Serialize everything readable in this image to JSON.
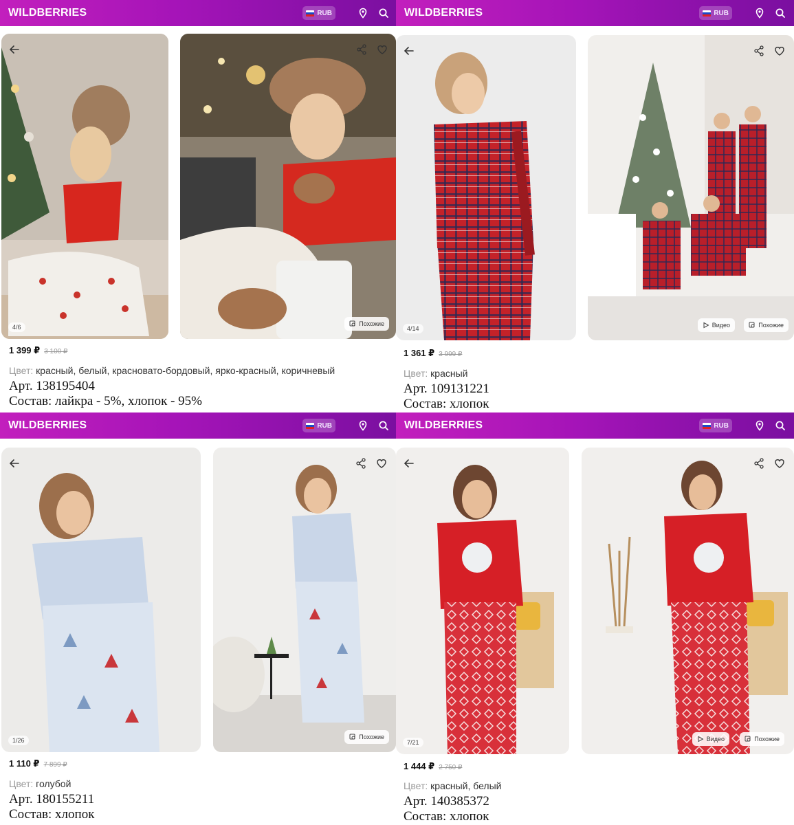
{
  "app": {
    "logo": "WILDBERRIES",
    "currency": "RUB"
  },
  "panels": [
    {
      "counter": "4/6",
      "similar": "Похожие",
      "price": "1 399 ₽",
      "old_price": "3 100 ₽",
      "color_label": "Цвет:",
      "color_value": "красный, белый, красновато-бордовый, ярко-красный, коричневый",
      "article": "Арт. 138195404",
      "composition": "Состав: лайкра - 5%, хлопок - 95%"
    },
    {
      "counter": "4/14",
      "video": "Видео",
      "similar": "Похожие",
      "price": "1 361 ₽",
      "old_price": "3 999 ₽",
      "color_label": "Цвет:",
      "color_value": "красный",
      "article": "Арт. 109131221",
      "composition": "Состав: хлопок"
    },
    {
      "counter": "1/26",
      "similar": "Похожие",
      "price": "1 110 ₽",
      "old_price": "7 899 ₽",
      "color_label": "Цвет:",
      "color_value": "голубой",
      "article": "Арт. 180155211",
      "composition": "Состав: хлопок"
    },
    {
      "counter": "7/21",
      "video": "Видео",
      "similar": "Похожие",
      "price": "1 444 ₽",
      "old_price": "2 750 ₽",
      "color_label": "Цвет:",
      "color_value": "красный, белый",
      "article": "Арт. 140385372",
      "composition": "Состав: хлопок"
    }
  ],
  "icons": {
    "location": "location-pin-icon",
    "search": "search-icon",
    "back": "arrow-left-icon",
    "share": "share-icon",
    "favorite": "heart-icon",
    "similar": "similar-search-icon",
    "video": "play-icon"
  }
}
